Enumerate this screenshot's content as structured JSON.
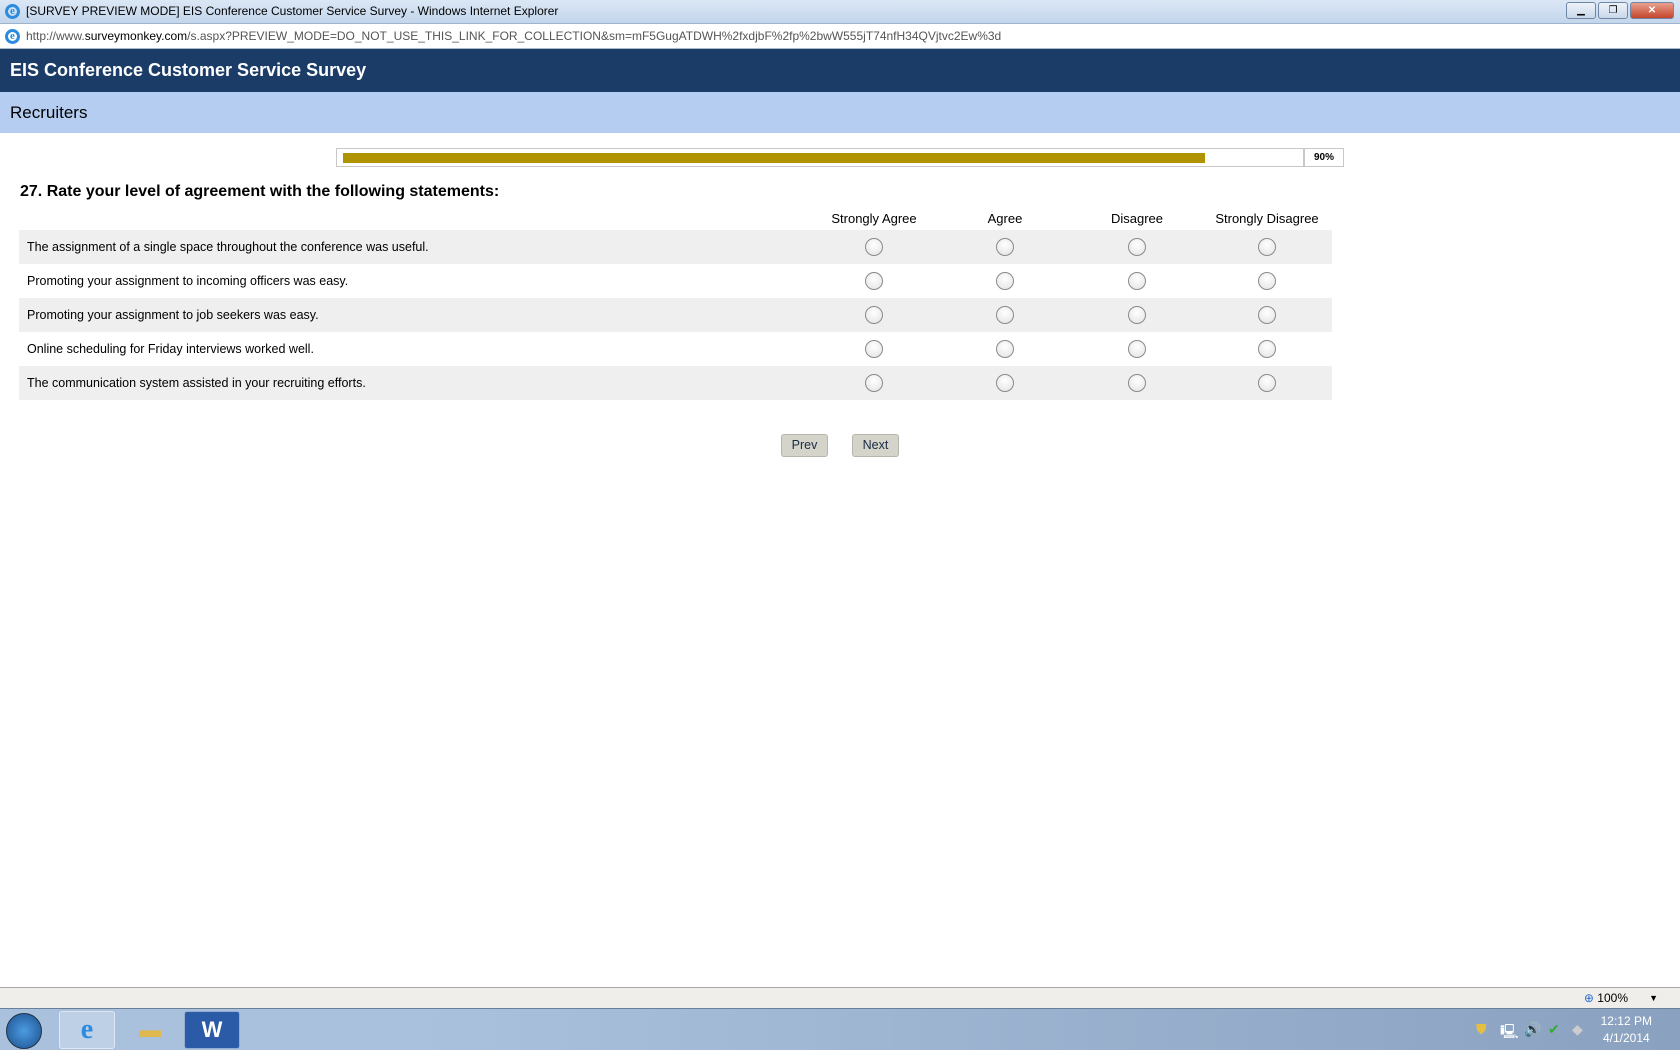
{
  "window": {
    "title": "[SURVEY PREVIEW MODE] EIS Conference Customer Service Survey - Windows Internet Explorer",
    "controls": [
      "minimize",
      "restore",
      "close"
    ]
  },
  "address": {
    "prefix": "http://www.",
    "domain": "surveymonkey.com",
    "path": "/s.aspx?PREVIEW_MODE=DO_NOT_USE_THIS_LINK_FOR_COLLECTION&sm=mF5GugATDWH%2fxdjbF%2fp%2bwW555jT74nfH34QVjtvc2Ew%3d"
  },
  "survey": {
    "title": "EIS Conference Customer Service Survey",
    "page_title": "Recruiters",
    "progress_percent": 90,
    "progress_label": "90%"
  },
  "question": {
    "title": "27. Rate your level of agreement with the following statements:",
    "columns": [
      "Strongly Agree",
      "Agree",
      "Disagree",
      "Strongly Disagree"
    ],
    "rows": [
      "The assignment of a single space throughout the conference was useful.",
      "Promoting your assignment to incoming officers was easy.",
      "Promoting your assignment to job seekers was easy.",
      "Online scheduling for Friday interviews worked well.",
      "The communication system assisted in your recruiting efforts."
    ]
  },
  "nav": {
    "prev": "Prev",
    "next": "Next"
  },
  "status": {
    "zoom": "100%"
  },
  "taskbar": {
    "time": "12:12 PM",
    "date": "4/1/2014",
    "apps": [
      "Internet Explorer",
      "Windows Explorer",
      "Microsoft Word"
    ]
  },
  "colors": {
    "header": "#1a3c66",
    "subheader": "#b4cdf0",
    "progress": "#b09300"
  }
}
